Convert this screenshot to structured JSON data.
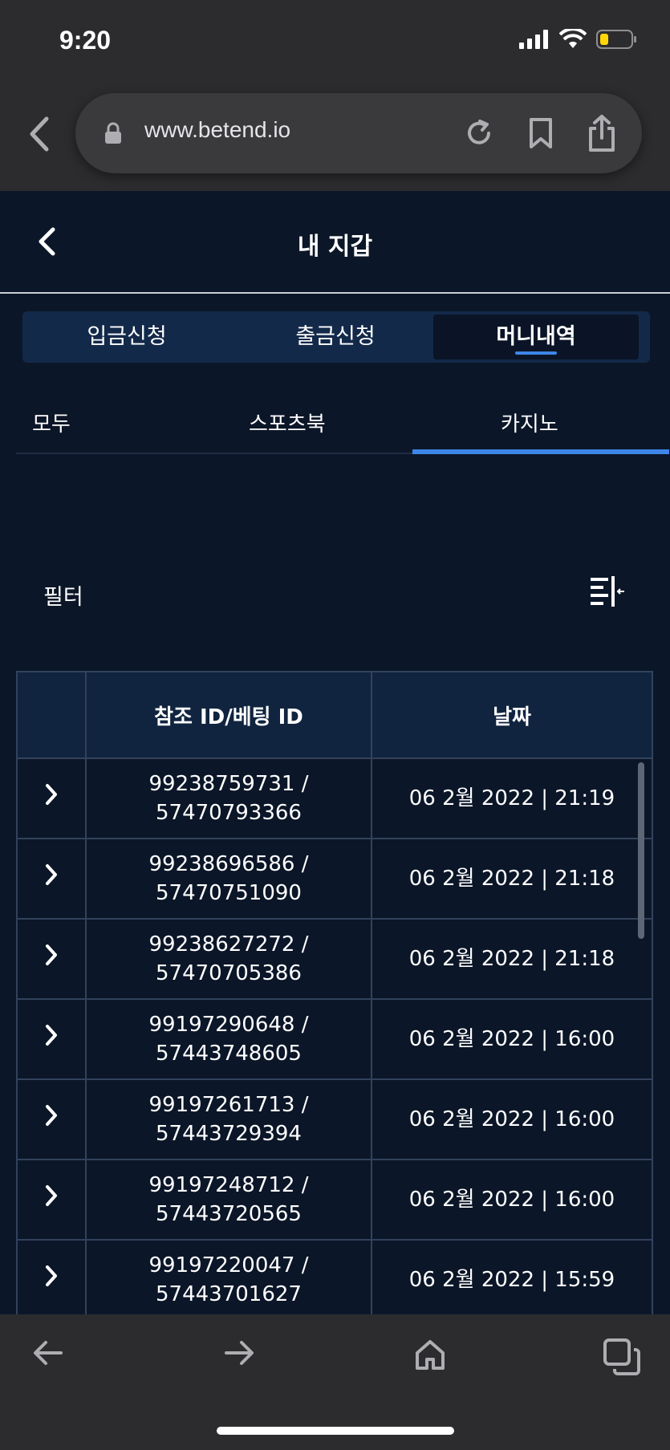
{
  "status_bar": {
    "time": "9:20"
  },
  "browser": {
    "url": "www.betend.io"
  },
  "header": {
    "title": "내 지갑"
  },
  "tabs": [
    {
      "label": "입금신청",
      "active": false
    },
    {
      "label": "출금신청",
      "active": false
    },
    {
      "label": "머니내역",
      "active": true
    }
  ],
  "subtabs": [
    {
      "label": "모두",
      "active": false
    },
    {
      "label": "스포츠북",
      "active": false
    },
    {
      "label": "카지노",
      "active": true
    }
  ],
  "filter": {
    "label": "필터"
  },
  "table": {
    "headers": [
      "",
      "참조 ID/베팅 ID",
      "날짜"
    ],
    "rows": [
      {
        "ref": "99238759731 /",
        "bet": "57470793366",
        "date": "06 2월 2022 | 21:19"
      },
      {
        "ref": "99238696586 /",
        "bet": "57470751090",
        "date": "06 2월 2022 | 21:18"
      },
      {
        "ref": "99238627272 /",
        "bet": "57470705386",
        "date": "06 2월 2022 | 21:18"
      },
      {
        "ref": "99197290648 /",
        "bet": "57443748605",
        "date": "06 2월 2022 | 16:00"
      },
      {
        "ref": "99197261713 /",
        "bet": "57443729394",
        "date": "06 2월 2022 | 16:00"
      },
      {
        "ref": "99197248712 /",
        "bet": "57443720565",
        "date": "06 2월 2022 | 16:00"
      },
      {
        "ref": "99197220047 /",
        "bet": "57443701627",
        "date": "06 2월 2022 | 15:59"
      }
    ]
  },
  "colors": {
    "accent": "#3d86e8",
    "background": "#0b1628",
    "header_bg": "#10243f"
  }
}
